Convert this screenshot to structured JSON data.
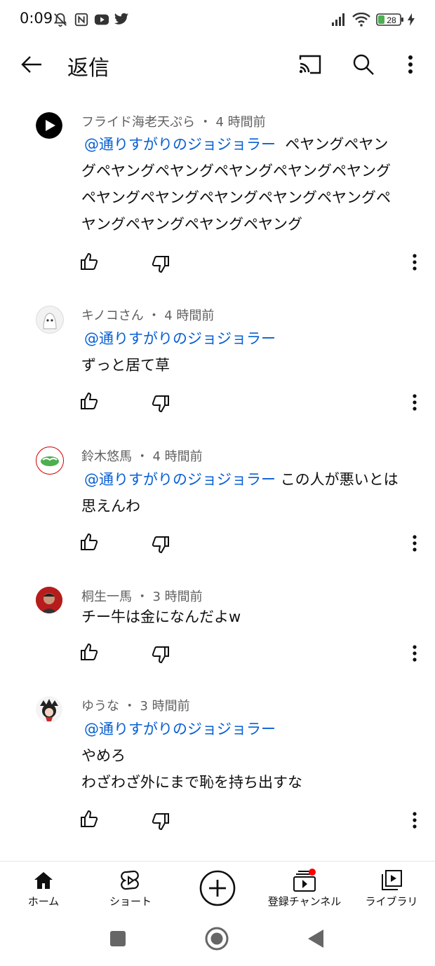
{
  "status_bar": {
    "time": "0:09",
    "battery": "28",
    "icons": [
      "bell-off-icon",
      "nfc-icon",
      "youtube-icon",
      "twitter-icon",
      "signal-icon",
      "wifi-icon",
      "battery-icon",
      "charging-icon"
    ]
  },
  "app_bar": {
    "title": "返信",
    "icons": [
      "back-arrow-icon",
      "cast-icon",
      "search-icon",
      "more-vert-icon"
    ]
  },
  "comments": [
    {
      "author": "フライド海老天ぷら",
      "time": "4 時間前",
      "mention": "@通りすがりのジョジョラー",
      "lines": [
        "ペヤングペヤン",
        "グペヤングペヤングペヤングペヤングペヤング",
        "ペヤングペヤングペヤングペヤングペヤングペ",
        "ヤングペヤングペヤングペヤング"
      ]
    },
    {
      "author": "キノコさん",
      "time": "4 時間前",
      "mention": "@通りすがりのジョジョラー",
      "lines": [
        "ずっと居て草"
      ]
    },
    {
      "author": "鈴木悠馬",
      "time": "4 時間前",
      "mention": "@通りすがりのジョジョラー",
      "lines": [
        "この人が悪いとは",
        "思えんわ"
      ]
    },
    {
      "author": "桐生一馬",
      "time": "3 時間前",
      "mention": "",
      "lines": [
        "チー牛は金になんだよw"
      ]
    },
    {
      "author": "ゆうな",
      "time": "3 時間前",
      "mention": "@通りすがりのジョジョラー",
      "lines": [
        "やめろ",
        "わざわざ外にまで恥を持ち出すな"
      ]
    }
  ],
  "comment_actions": [
    "like-icon",
    "dislike-icon",
    "more-vert-icon"
  ],
  "bottom_nav": {
    "items": [
      {
        "label": "ホーム",
        "icon": "home-icon"
      },
      {
        "label": "ショート",
        "icon": "shorts-icon"
      },
      {
        "label": "",
        "icon": "create-plus-icon"
      },
      {
        "label": "登録チャンネル",
        "icon": "subscriptions-icon"
      },
      {
        "label": "ライブラリ",
        "icon": "library-icon"
      }
    ]
  },
  "system_nav": [
    "recents-square-icon",
    "home-circle-icon",
    "back-triangle-icon"
  ],
  "colors": {
    "mention": "#065fd4",
    "meta": "#606060",
    "notification_dot": "#ff0000",
    "battery_fill": "#4caf50"
  }
}
